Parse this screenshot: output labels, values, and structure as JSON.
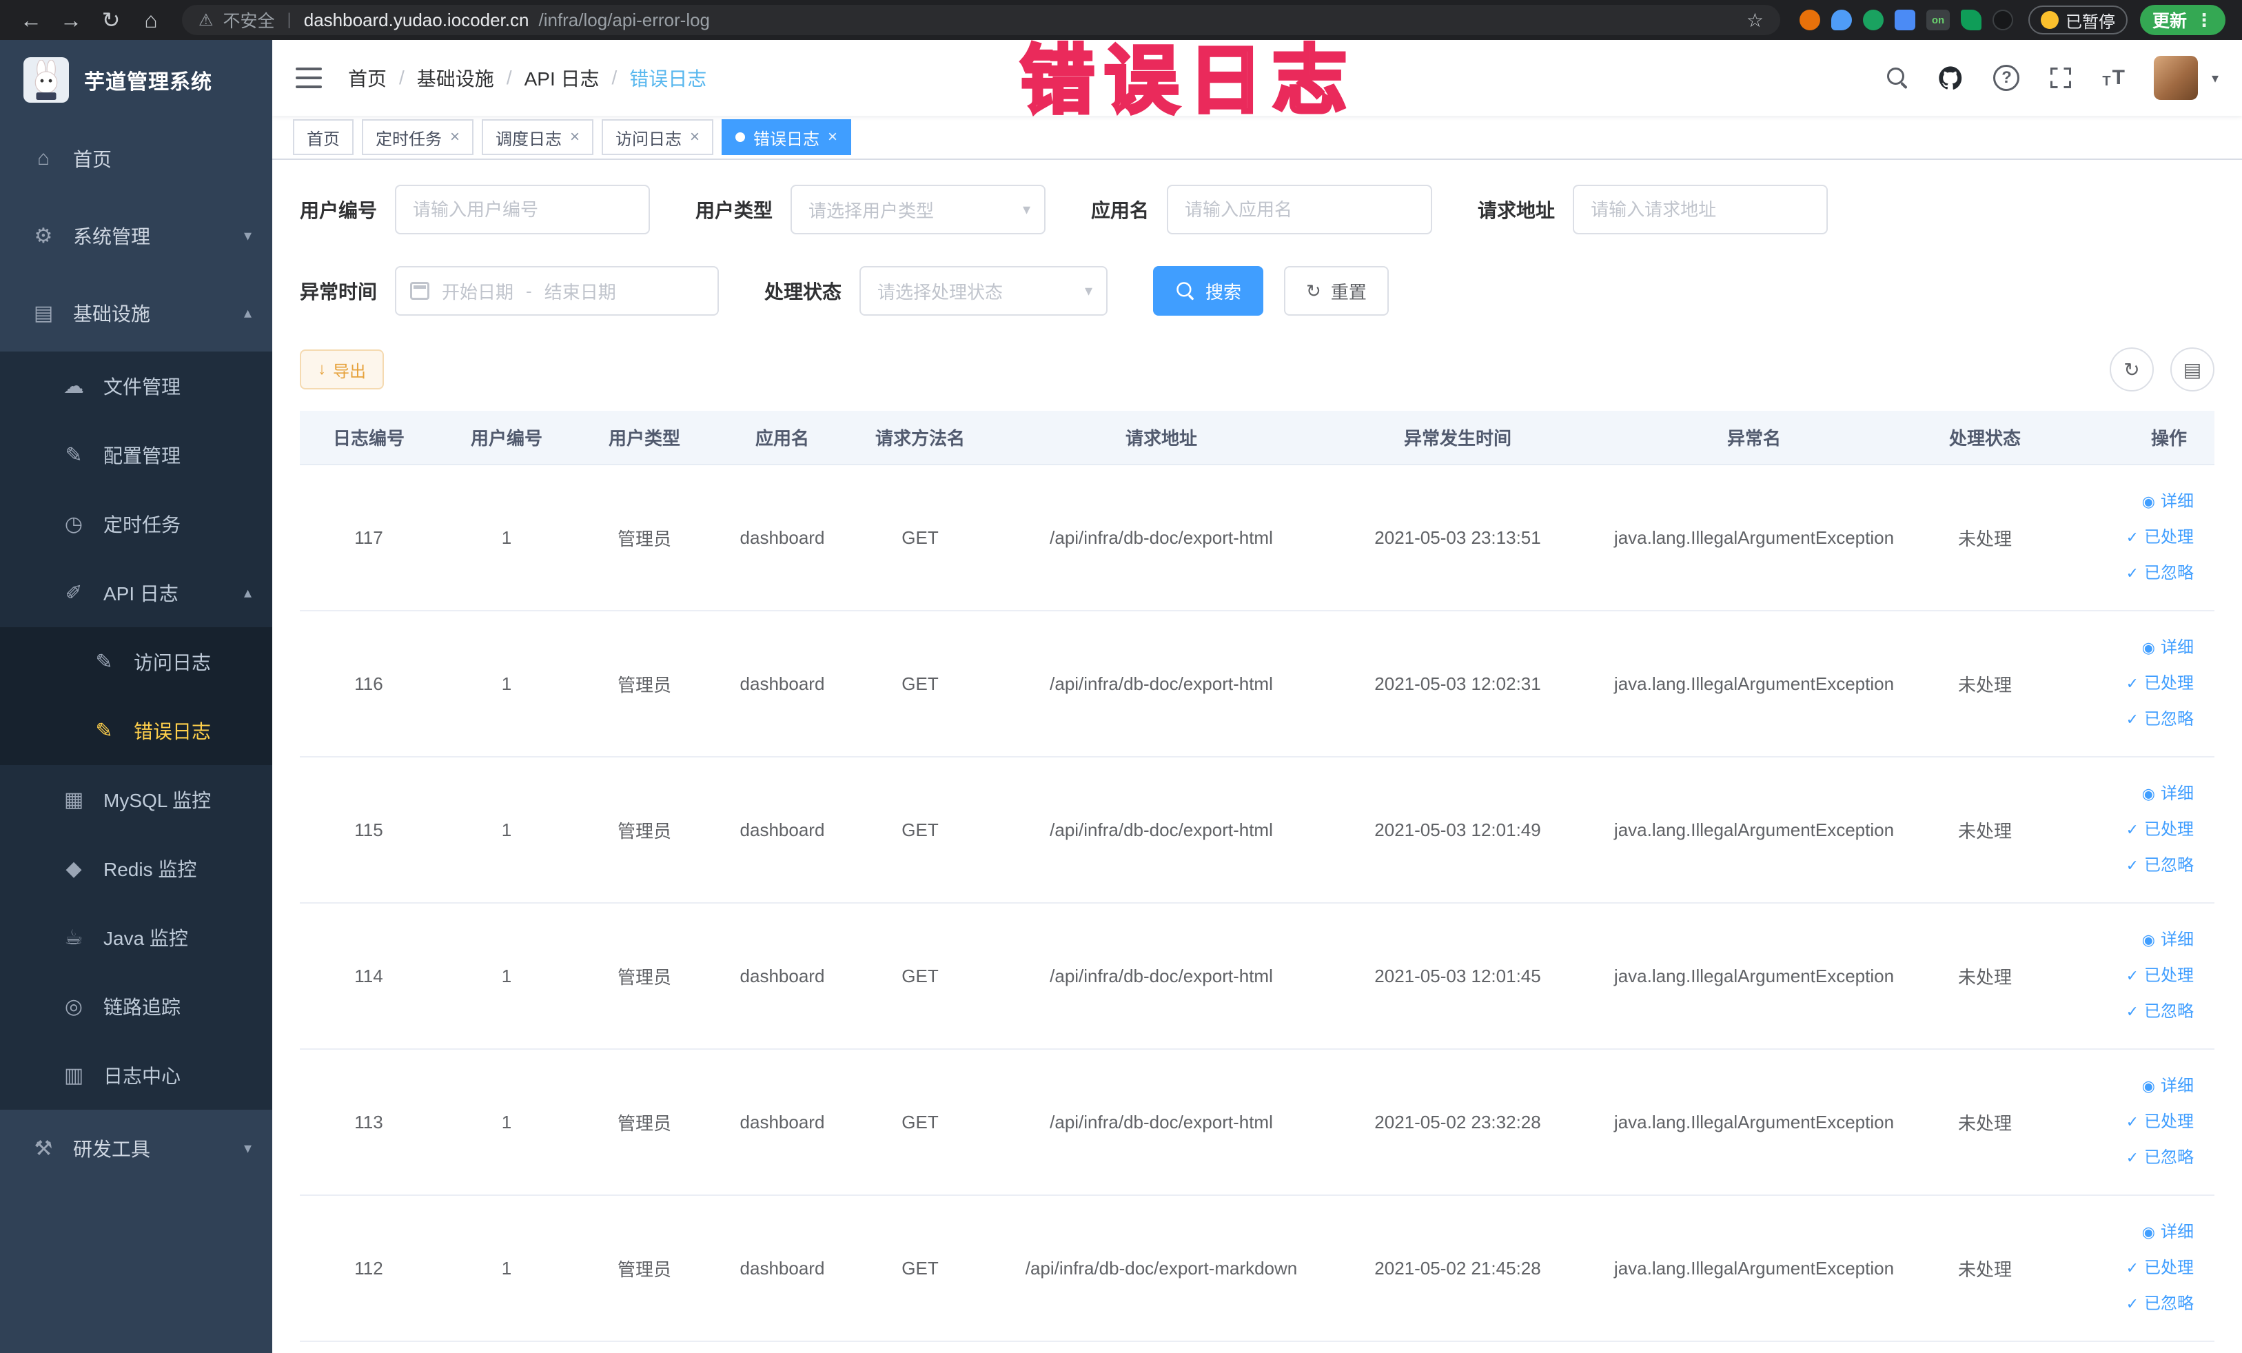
{
  "watermark": "错误日志",
  "browser": {
    "security_label": "不安全",
    "url_host": "dashboard.yudao.iocoder.cn",
    "url_path": "/infra/log/api-error-log",
    "ext_on_badge": "on",
    "paused_badge": "已暂停",
    "update_button": "更新"
  },
  "icons": {
    "back": "←",
    "forward": "→",
    "reload": "↻",
    "home": "⌂",
    "warning": "⚠",
    "separator": "|",
    "star": "☆",
    "menu_dots": "⋮",
    "breadcrumb_sep": "/",
    "question": "?",
    "font_small": "T",
    "font_big": "T",
    "caret_down": "▾",
    "chevron_down": "▾",
    "chevron_up": "▴",
    "close": "×",
    "date_separator": "-",
    "refresh": "↻",
    "columns": "▤",
    "download": "↓",
    "eye": "◉",
    "check": "✓"
  },
  "sidebar": {
    "logo_title": "芋道管理系统",
    "items": [
      {
        "label": "首页",
        "icon_glyph": "⌂"
      },
      {
        "label": "系统管理",
        "icon_glyph": "⚙"
      },
      {
        "label": "基础设施",
        "icon_glyph": "▤"
      },
      {
        "label": "文件管理",
        "icon_glyph": "☁"
      },
      {
        "label": "配置管理",
        "icon_glyph": "✎"
      },
      {
        "label": "定时任务",
        "icon_glyph": "◷"
      },
      {
        "label": "API 日志",
        "icon_glyph": "✐"
      },
      {
        "label": "访问日志",
        "icon_glyph": "✎"
      },
      {
        "label": "错误日志",
        "icon_glyph": "✎"
      },
      {
        "label": "MySQL 监控",
        "icon_glyph": "▦"
      },
      {
        "label": "Redis 监控",
        "icon_glyph": "◆"
      },
      {
        "label": "Java 监控",
        "icon_glyph": "☕"
      },
      {
        "label": "链路追踪",
        "icon_glyph": "◎"
      },
      {
        "label": "日志中心",
        "icon_glyph": "▥"
      },
      {
        "label": "研发工具",
        "icon_glyph": "⚒"
      }
    ]
  },
  "header": {
    "breadcrumb": [
      "首页",
      "基础设施",
      "API 日志",
      "错误日志"
    ]
  },
  "tabs": [
    {
      "label": "首页"
    },
    {
      "label": "定时任务"
    },
    {
      "label": "调度日志"
    },
    {
      "label": "访问日志"
    },
    {
      "label": "错误日志"
    }
  ],
  "filters": {
    "user_id_label": "用户编号",
    "user_id_placeholder": "请输入用户编号",
    "user_type_label": "用户类型",
    "user_type_placeholder": "请选择用户类型",
    "app_name_label": "应用名",
    "app_name_placeholder": "请输入应用名",
    "request_url_label": "请求地址",
    "request_url_placeholder": "请输入请求地址",
    "exception_time_label": "异常时间",
    "start_date_placeholder": "开始日期",
    "end_date_placeholder": "结束日期",
    "process_status_label": "处理状态",
    "process_status_placeholder": "请选择处理状态",
    "search_button": "搜索",
    "reset_button": "重置"
  },
  "toolbar": {
    "export_button": "导出"
  },
  "table": {
    "columns": [
      "日志编号",
      "用户编号",
      "用户类型",
      "应用名",
      "请求方法名",
      "请求地址",
      "异常发生时间",
      "异常名",
      "处理状态",
      "操作"
    ],
    "action_labels": {
      "detail": "详细",
      "process": "已处理",
      "ignore": "已忽略"
    },
    "rows": [
      {
        "log_id": "117",
        "user_id": "1",
        "user_type": "管理员",
        "app_name": "dashboard",
        "method": "GET",
        "url": "/api/infra/db-doc/export-html",
        "time": "2021-05-03 23:13:51",
        "exception": "java.lang.IllegalArgumentException",
        "status": "未处理"
      },
      {
        "log_id": "116",
        "user_id": "1",
        "user_type": "管理员",
        "app_name": "dashboard",
        "method": "GET",
        "url": "/api/infra/db-doc/export-html",
        "time": "2021-05-03 12:02:31",
        "exception": "java.lang.IllegalArgumentException",
        "status": "未处理"
      },
      {
        "log_id": "115",
        "user_id": "1",
        "user_type": "管理员",
        "app_name": "dashboard",
        "method": "GET",
        "url": "/api/infra/db-doc/export-html",
        "time": "2021-05-03 12:01:49",
        "exception": "java.lang.IllegalArgumentException",
        "status": "未处理"
      },
      {
        "log_id": "114",
        "user_id": "1",
        "user_type": "管理员",
        "app_name": "dashboard",
        "method": "GET",
        "url": "/api/infra/db-doc/export-html",
        "time": "2021-05-03 12:01:45",
        "exception": "java.lang.IllegalArgumentException",
        "status": "未处理"
      },
      {
        "log_id": "113",
        "user_id": "1",
        "user_type": "管理员",
        "app_name": "dashboard",
        "method": "GET",
        "url": "/api/infra/db-doc/export-html",
        "time": "2021-05-02 23:32:28",
        "exception": "java.lang.IllegalArgumentException",
        "status": "未处理"
      },
      {
        "log_id": "112",
        "user_id": "1",
        "user_type": "管理员",
        "app_name": "dashboard",
        "method": "GET",
        "url": "/api/infra/db-doc/export-markdown",
        "time": "2021-05-02 21:45:28",
        "exception": "java.lang.IllegalArgumentException",
        "status": "未处理"
      }
    ]
  }
}
